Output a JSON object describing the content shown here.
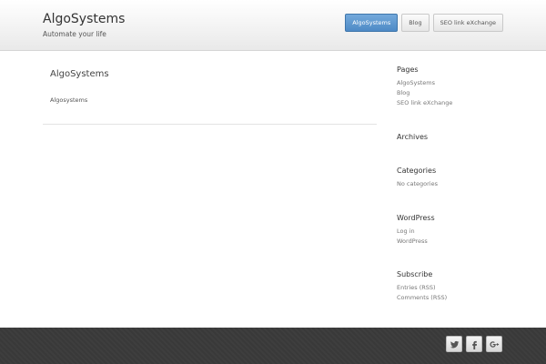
{
  "header": {
    "site_title": "AlgoSystems",
    "tagline": "Automate your life",
    "nav": [
      {
        "label": "AlgoSystems",
        "active": true
      },
      {
        "label": "Blog",
        "active": false
      },
      {
        "label": "SEO link eXchange",
        "active": false
      }
    ]
  },
  "main": {
    "post_title": "AlgoSystems",
    "post_body": "Algosystems"
  },
  "sidebar": {
    "pages": {
      "title": "Pages",
      "items": [
        "AlgoSystems",
        "Blog",
        "SEO link eXchange"
      ]
    },
    "archives": {
      "title": "Archives"
    },
    "categories": {
      "title": "Categories",
      "items": [
        "No categories"
      ]
    },
    "wordpress": {
      "title": "WordPress",
      "items": [
        "Log in",
        "WordPress"
      ]
    },
    "subscribe": {
      "title": "Subscribe",
      "items": [
        "Entries (RSS)",
        "Comments (RSS)"
      ]
    }
  },
  "footer": {
    "social": [
      "twitter-icon",
      "facebook-icon",
      "google-plus-icon"
    ]
  },
  "colors": {
    "accent": "#4e8ac6",
    "footer_bg": "#3a3a3a"
  }
}
